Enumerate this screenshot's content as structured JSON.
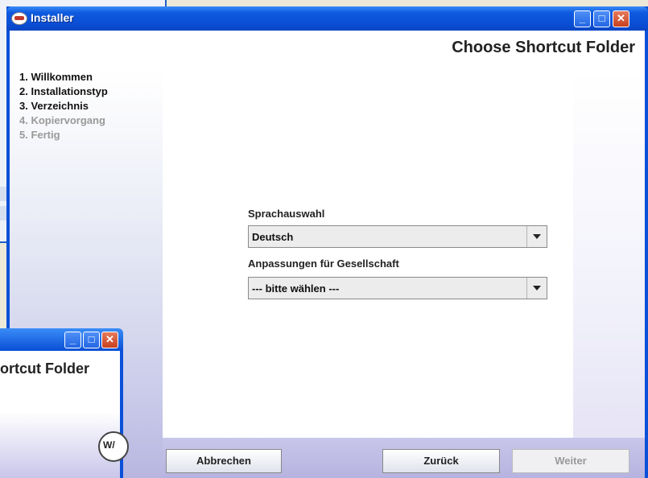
{
  "window": {
    "title": "Installer",
    "minimize_glyph": "_",
    "maximize_glyph": "□",
    "close_glyph": "✕"
  },
  "header": {
    "title": "Choose Shortcut Folder"
  },
  "steps": [
    {
      "label": "1. Willkommen",
      "state": "done"
    },
    {
      "label": "2. Installationstyp",
      "state": "done"
    },
    {
      "label": "3. Verzeichnis",
      "state": "current"
    },
    {
      "label": "4. Kopiervorgang",
      "state": "pending"
    },
    {
      "label": "5. Fertig",
      "state": "pending"
    }
  ],
  "form": {
    "language_label": "Sprachauswahl",
    "language_value": "Deutsch",
    "company_label": "Anpassungen für Gesellschaft",
    "company_value": "--- bitte wählen ---"
  },
  "buttons": {
    "cancel": "Abbrechen",
    "back": "Zurück",
    "next": "Weiter"
  },
  "overlay": {
    "title": "ortcut Folder"
  },
  "colors": {
    "titlebar": "#0a4fd6",
    "close_button": "#c8401f",
    "footer": "#b6b3e0"
  }
}
